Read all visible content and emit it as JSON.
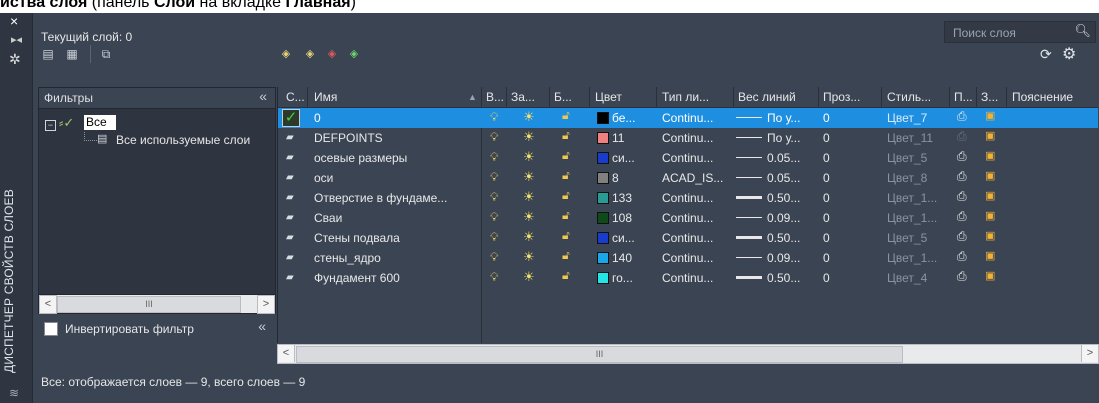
{
  "caption": {
    "bold1": "йства слоя",
    "mid": " (панель ",
    "bold2": "Слои",
    "mid2": " на вкладке ",
    "bold3": "Главная",
    "end": ")"
  },
  "sidebar": {
    "title": "ДИСПЕТЧЕР СВОЙСТВ СЛОЕВ",
    "close_icon": "×"
  },
  "current_layer": "Текущий слой: 0",
  "search": {
    "placeholder": "Поиск слоя"
  },
  "filters": {
    "header": "Фильтры",
    "collapse": "«",
    "tree": {
      "all": "Все",
      "used": "Все используемые слои"
    }
  },
  "invert_filter": {
    "label": "Инвертировать фильтр",
    "checked": false
  },
  "status_text": "Все: отображается слоев — 9, всего слоев — 9",
  "columns": [
    "С...",
    "Имя",
    "В...",
    "За...",
    "Б...",
    "Цвет",
    "Тип ли...",
    "Вес линий",
    "Проз...",
    "Стиль...",
    "П...",
    "З...",
    "Пояснение"
  ],
  "layers": [
    {
      "name": "0",
      "color_hex": "#000000",
      "color_name": "бе...",
      "linetype": "Continu...",
      "lineweight": "По у...",
      "transparency": "0",
      "plot_style": "Цвет_7",
      "plot": true,
      "current": true,
      "thick": false,
      "selected": true
    },
    {
      "name": "DEFPOINTS",
      "color_hex": "#f08080",
      "color_name": "11",
      "linetype": "Continu...",
      "lineweight": "По у...",
      "transparency": "0",
      "plot_style": "Цвет_11",
      "plot": false,
      "current": false,
      "thick": false,
      "selected": false
    },
    {
      "name": "осевые размеры",
      "color_hex": "#1a3ccc",
      "color_name": "си...",
      "linetype": "Continu...",
      "lineweight": "0.05...",
      "transparency": "0",
      "plot_style": "Цвет_5",
      "plot": true,
      "current": false,
      "thick": false,
      "selected": false
    },
    {
      "name": "оси",
      "color_hex": "#808080",
      "color_name": "8",
      "linetype": "ACAD_IS...",
      "lineweight": "0.05...",
      "transparency": "0",
      "plot_style": "Цвет_8",
      "plot": true,
      "current": false,
      "thick": false,
      "selected": false
    },
    {
      "name": "Отверстие в фундаме...",
      "color_hex": "#2a9a94",
      "color_name": "133",
      "linetype": "Continu...",
      "lineweight": "0.50...",
      "transparency": "0",
      "plot_style": "Цвет_1...",
      "plot": true,
      "current": false,
      "thick": true,
      "selected": false
    },
    {
      "name": "Сваи",
      "color_hex": "#0f4a1a",
      "color_name": "108",
      "linetype": "Continu...",
      "lineweight": "0.09...",
      "transparency": "0",
      "plot_style": "Цвет_1...",
      "plot": true,
      "current": false,
      "thick": false,
      "selected": false
    },
    {
      "name": "Стены подвала",
      "color_hex": "#1a3ccc",
      "color_name": "си...",
      "linetype": "Continu...",
      "lineweight": "0.50...",
      "transparency": "0",
      "plot_style": "Цвет_5",
      "plot": true,
      "current": false,
      "thick": true,
      "selected": false
    },
    {
      "name": "стены_ядро",
      "color_hex": "#1aa7e8",
      "color_name": "140",
      "linetype": "Continu...",
      "lineweight": "0.09...",
      "transparency": "0",
      "plot_style": "Цвет_1...",
      "plot": true,
      "current": false,
      "thick": false,
      "selected": false
    },
    {
      "name": "Фундамент 600",
      "color_hex": "#22e5e5",
      "color_name": "го...",
      "linetype": "Continu...",
      "lineweight": "0.50...",
      "transparency": "0",
      "plot_style": "Цвет_4",
      "plot": true,
      "current": false,
      "thick": true,
      "selected": false
    }
  ]
}
